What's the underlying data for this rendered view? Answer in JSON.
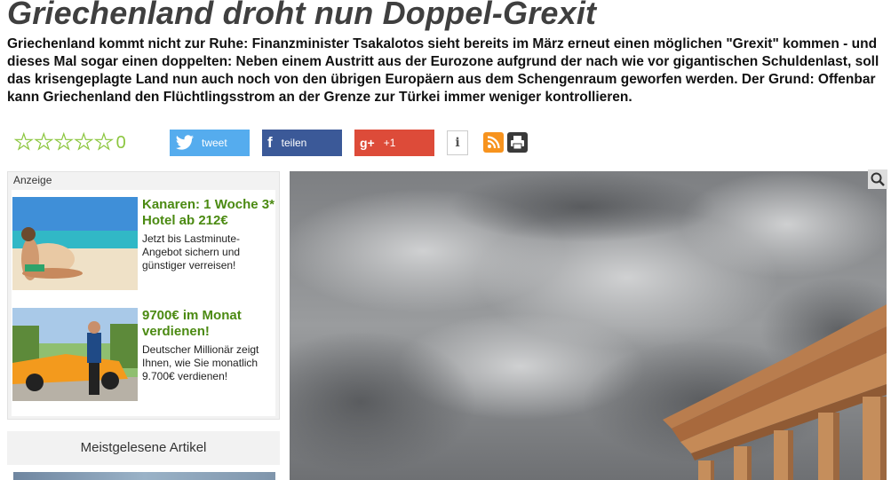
{
  "article": {
    "title": "Griechenland droht nun Doppel-Grexit",
    "lead": "Griechenland kommt nicht zur Ruhe: Finanzminister Tsakalotos sieht bereits im März erneut einen möglichen \"Grexit\" kommen - und dieses Mal sogar einen doppelten: Neben einem Austritt aus der Eurozone aufgrund der nach wie vor gigantischen Schuldenlast, soll das krisengeplagte Land nun auch noch von den übrigen Europäern aus dem Schengenraum geworfen werden. Der Grund: Offenbar kann Griechenland den Flüchtlingsstrom an der Grenze zur Türkei immer weniger kontrollieren."
  },
  "rating": {
    "stars": 5,
    "filled": 0,
    "count": "0"
  },
  "share": {
    "twitter_label": "tweet",
    "facebook_label": "teilen",
    "gplus_label": "+1",
    "gplus_icon": "g+",
    "info_label": "i"
  },
  "sidebar": {
    "ad_label": "Anzeige",
    "ads": [
      {
        "title": "Kanaren: 1 Woche 3* Hotel ab 212€",
        "text": "Jetzt bis Lastminute-Angebot sichern und günstiger verreisen!"
      },
      {
        "title": "9700€ im Monat verdienen!",
        "text": "Deutscher Millionär zeigt Ihnen, wie Sie monatlich 9.700€ verdienen!"
      }
    ],
    "most_read": "Meistgelesene Artikel"
  },
  "colors": {
    "twitter": "#55acee",
    "facebook": "#3b5998",
    "gplus": "#dd4b39",
    "rss": "#f7931e",
    "ad_green": "#4b8a12",
    "star_green": "#8cc63f"
  }
}
